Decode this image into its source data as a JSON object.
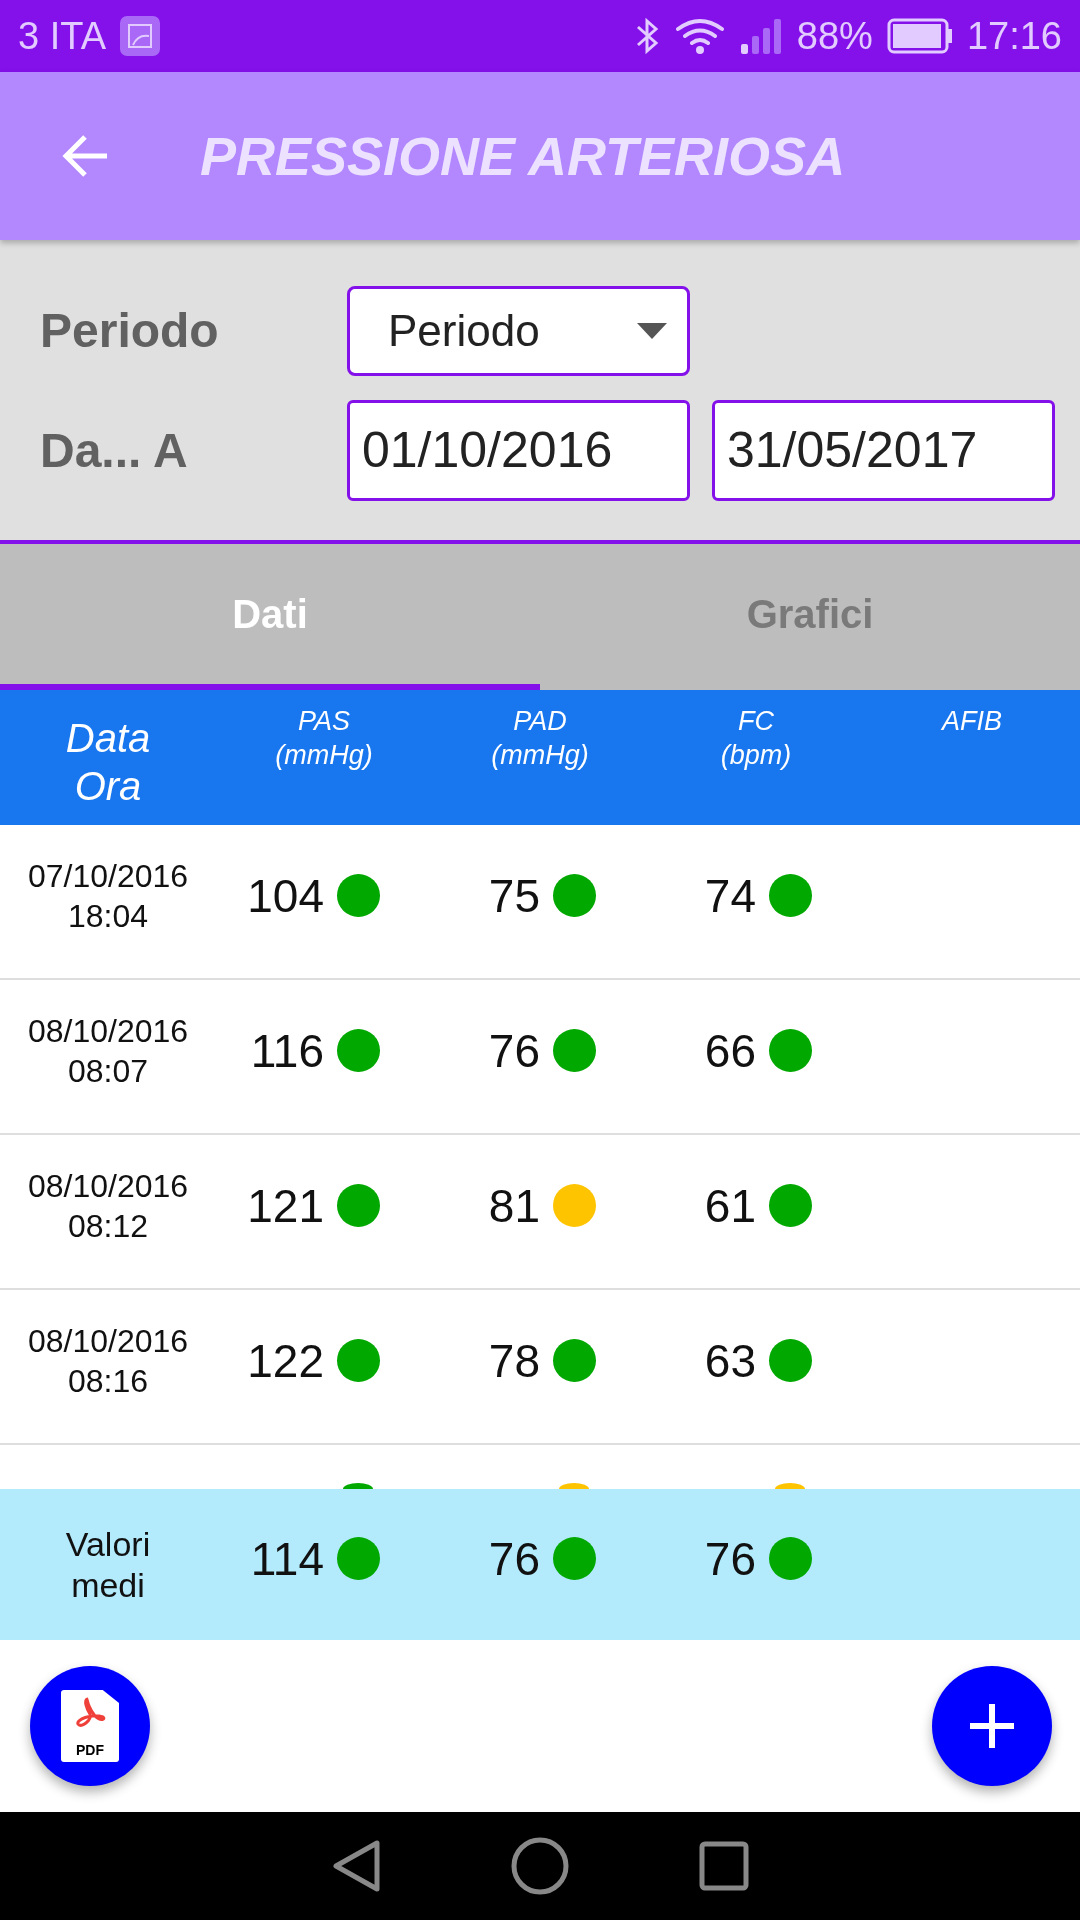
{
  "status_bar": {
    "carrier": "3 ITA",
    "battery": "88%",
    "time": "17:16"
  },
  "header": {
    "title": "PRESSIONE ARTERIOSA"
  },
  "filters": {
    "period_label": "Periodo",
    "period_value": "Periodo",
    "range_label": "Da... A",
    "from": "01/10/2016",
    "to": "31/05/2017"
  },
  "tabs": [
    {
      "label": "Dati",
      "selected": true
    },
    {
      "label": "Grafici",
      "selected": false
    }
  ],
  "table": {
    "columns": [
      {
        "kind": "large",
        "lines": [
          "Data",
          "Ora"
        ]
      },
      {
        "kind": "small",
        "lines": [
          "PAS",
          "(mmHg)"
        ]
      },
      {
        "kind": "small",
        "lines": [
          "PAD",
          "(mmHg)"
        ]
      },
      {
        "kind": "small",
        "lines": [
          "FC",
          "(bpm)"
        ]
      },
      {
        "kind": "small",
        "lines": [
          "AFIB"
        ]
      }
    ],
    "rows": [
      {
        "date": "07/10/2016",
        "time": "18:04",
        "values": [
          {
            "text": "104",
            "color": "#00a800"
          },
          {
            "text": "75",
            "color": "#00a800"
          },
          {
            "text": "74",
            "color": "#00a800"
          }
        ]
      },
      {
        "date": "08/10/2016",
        "time": "08:07",
        "values": [
          {
            "text": "116",
            "color": "#00a800"
          },
          {
            "text": "76",
            "color": "#00a800"
          },
          {
            "text": "66",
            "color": "#00a800"
          }
        ]
      },
      {
        "date": "08/10/2016",
        "time": "08:12",
        "values": [
          {
            "text": "121",
            "color": "#00a800"
          },
          {
            "text": "81",
            "color": "#ffc400"
          },
          {
            "text": "61",
            "color": "#00a800"
          }
        ]
      },
      {
        "date": "08/10/2016",
        "time": "08:16",
        "values": [
          {
            "text": "122",
            "color": "#00a800"
          },
          {
            "text": "78",
            "color": "#00a800"
          },
          {
            "text": "63",
            "color": "#00a800"
          }
        ]
      }
    ],
    "partial_row": {
      "dots": [
        {
          "color": "#00a800"
        },
        {
          "color": "#ffc400"
        },
        {
          "color": "#ffc400"
        }
      ]
    },
    "average": {
      "label": "Valori medi",
      "values": [
        {
          "text": "114",
          "color": "#00a800"
        },
        {
          "text": "76",
          "color": "#00a800"
        },
        {
          "text": "76",
          "color": "#00a800"
        }
      ]
    }
  },
  "fab": {
    "pdf_label": "PDF"
  }
}
